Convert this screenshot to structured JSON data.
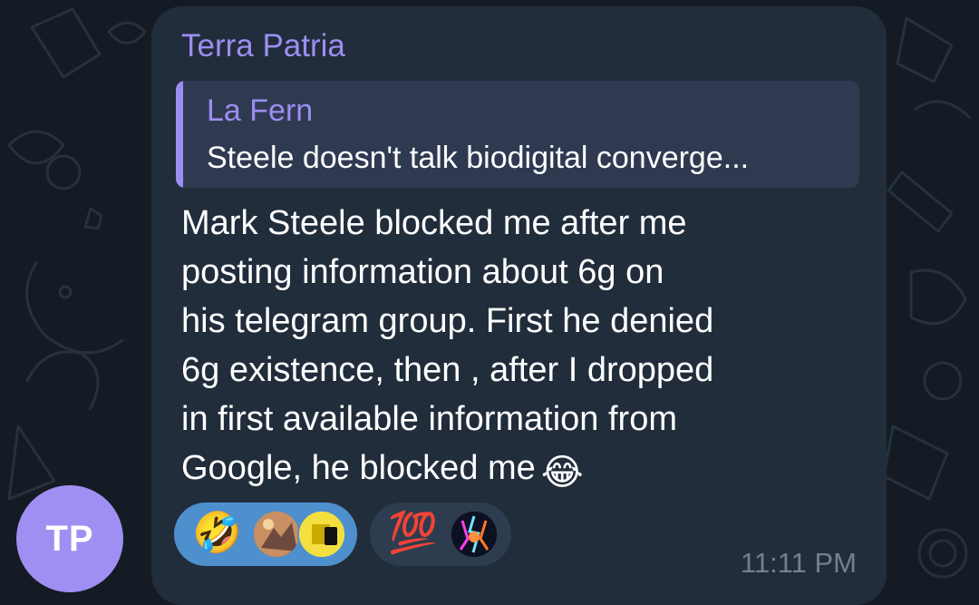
{
  "chat": {
    "avatar_initials": "TP",
    "avatar_color": "#9f8ff2",
    "accent_color": "#9c8ef1",
    "bubble_color": "#212d3b",
    "background_color": "#141b24"
  },
  "message": {
    "sender": "Terra Patria",
    "reply": {
      "author": "La Fern",
      "text": "Steele doesn't talk biodigital converge..."
    },
    "text": "Mark Steele blocked me after me\nposting information about 6g on\nhis telegram group. First he denied\n6g existence, then , after I dropped\nin first available information from\nGoogle, he blocked me",
    "trailing_emoji": "😂",
    "time": "11:11 PM"
  },
  "reactions": [
    {
      "emoji": "🤣",
      "icon": "rolling-laughing-emoji",
      "selected": true,
      "reactor_avatars": [
        "photo-avatar",
        "yellow-avatar"
      ]
    },
    {
      "emoji": "💯",
      "icon": "hundred-points-emoji",
      "selected": false,
      "reactor_avatars": [
        "neon-avatar"
      ]
    }
  ]
}
